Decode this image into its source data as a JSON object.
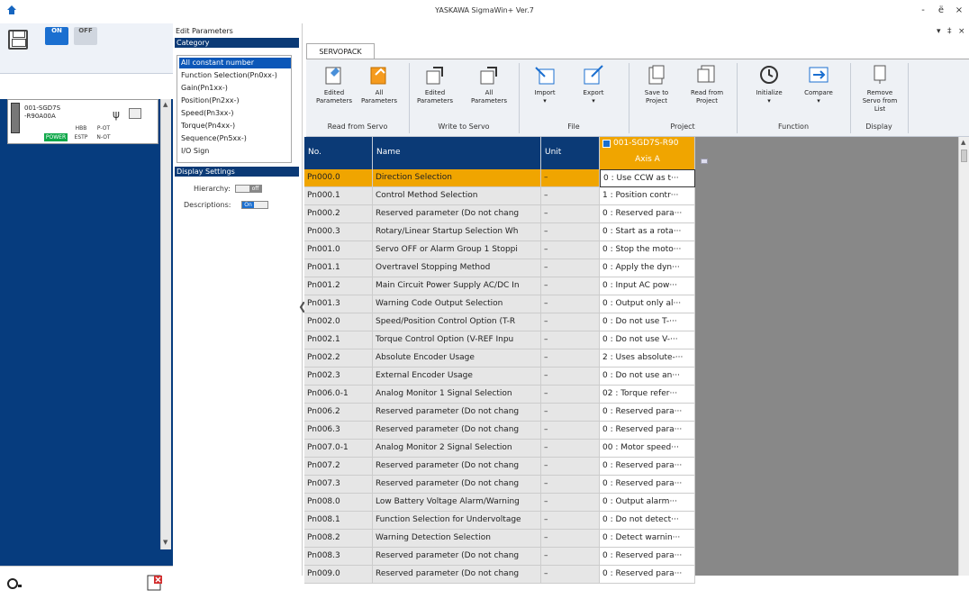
{
  "app": {
    "title": "YASKAWA SigmaWin+ Ver.7",
    "win_min": "-",
    "win_restore": "ё",
    "win_close": "×"
  },
  "left": {
    "on_label": "ON",
    "off_label": "OFF",
    "servo": {
      "name_line1": "001-SGD7S",
      "name_line2": "-R90A00A",
      "status": [
        "HBB",
        "P-OT",
        "POWER",
        "ESTP",
        "N-OT"
      ]
    }
  },
  "mid": {
    "edit_title": "Edit Parameters",
    "category_header": "Category",
    "categories": [
      "All constant number",
      "Function Selection(Pn0xx-)",
      "Gain(Pn1xx-)",
      "Position(Pn2xx-)",
      "Speed(Pn3xx-)",
      "Torque(Pn4xx-)",
      "Sequence(Pn5xx-)",
      "I/O Sign"
    ],
    "display_header": "Display Settings",
    "hierarchy_label": "Hierarchy:",
    "hierarchy_state": "off",
    "descriptions_label": "Descriptions:",
    "descriptions_state": "On"
  },
  "ribbon": {
    "tab": "SERVOPACK",
    "buttons": [
      {
        "l1": "Edited",
        "l2": "Parameters"
      },
      {
        "l1": "All",
        "l2": "Parameters"
      },
      {
        "l1": "Edited",
        "l2": "Parameters"
      },
      {
        "l1": "All",
        "l2": "Parameters"
      },
      {
        "l1": "Import",
        "l2": ""
      },
      {
        "l1": "Export",
        "l2": ""
      },
      {
        "l1": "Save to",
        "l2": "Project"
      },
      {
        "l1": "Read from",
        "l2": "Project"
      },
      {
        "l1": "Initialize",
        "l2": ""
      },
      {
        "l1": "Compare",
        "l2": ""
      },
      {
        "l1": "Remove",
        "l2": "Servo from",
        "l3": "List"
      }
    ],
    "groups": [
      "Read from Servo",
      "Write to Servo",
      "File",
      "Project",
      "Function",
      "Display"
    ]
  },
  "grid": {
    "col_no": "No.",
    "col_name": "Name",
    "col_unit": "Unit",
    "axis_title": "001-SGD7S-R90",
    "axis_sub": "Axis A",
    "rows": [
      [
        "Pn000.0",
        "Direction Selection",
        "–",
        "0 : Use CCW as t···"
      ],
      [
        "Pn000.1",
        "Control Method Selection",
        "–",
        "1 : Position contr···"
      ],
      [
        "Pn000.2",
        "Reserved parameter (Do not chang",
        "–",
        "0 : Reserved para···"
      ],
      [
        "Pn000.3",
        "Rotary/Linear Startup Selection Wh",
        "–",
        "0 : Start as a rota···"
      ],
      [
        "Pn001.0",
        "Servo OFF or Alarm Group 1 Stoppi",
        "–",
        "0 : Stop the moto···"
      ],
      [
        "Pn001.1",
        "Overtravel Stopping Method",
        "–",
        "0 : Apply the dyn···"
      ],
      [
        "Pn001.2",
        "Main Circuit Power Supply AC/DC In",
        "–",
        "0 : Input AC pow···"
      ],
      [
        "Pn001.3",
        "Warning Code Output Selection",
        "–",
        "0 : Output only al···"
      ],
      [
        "Pn002.0",
        "Speed/Position Control Option (T-R",
        "–",
        "0 : Do not use T-···"
      ],
      [
        "Pn002.1",
        "Torque Control Option (V-REF Inpu",
        "–",
        "0 : Do not use V-···"
      ],
      [
        "Pn002.2",
        "Absolute Encoder Usage",
        "–",
        "2 : Uses absolute-···"
      ],
      [
        "Pn002.3",
        "External Encoder Usage",
        "–",
        "0 : Do not use an···"
      ],
      [
        "Pn006.0-1",
        "Analog Monitor 1 Signal Selection",
        "–",
        "02 : Torque refer···"
      ],
      [
        "Pn006.2",
        "Reserved parameter (Do not chang",
        "–",
        "0 : Reserved para···"
      ],
      [
        "Pn006.3",
        "Reserved parameter (Do not chang",
        "–",
        "0 : Reserved para···"
      ],
      [
        "Pn007.0-1",
        "Analog Monitor 2 Signal Selection",
        "–",
        "00 : Motor speed···"
      ],
      [
        "Pn007.2",
        "Reserved parameter (Do not chang",
        "–",
        "0 : Reserved para···"
      ],
      [
        "Pn007.3",
        "Reserved parameter (Do not chang",
        "–",
        "0 : Reserved para···"
      ],
      [
        "Pn008.0",
        "Low Battery Voltage Alarm/Warning",
        "–",
        "0 : Output alarm···"
      ],
      [
        "Pn008.1",
        "Function Selection for Undervoltage",
        "–",
        "0 : Do not detect···"
      ],
      [
        "Pn008.2",
        "Warning Detection Selection",
        "–",
        "0 : Detect warnin···"
      ],
      [
        "Pn008.3",
        "Reserved parameter (Do not chang",
        "–",
        "0 : Reserved para···"
      ],
      [
        "Pn009.0",
        "Reserved parameter (Do not chang",
        "–",
        "0 : Reserved para···"
      ]
    ]
  },
  "colors": {
    "navy": "#063c7e",
    "header": "#0b3a76",
    "selected": "#f0a500",
    "power": "#10a84a"
  }
}
